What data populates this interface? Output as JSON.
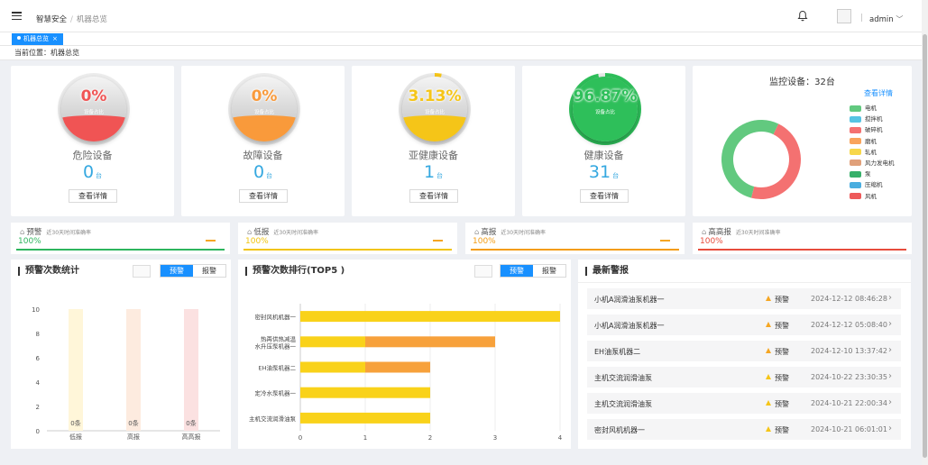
{
  "header": {
    "breadcrumb_root": "智慧安全",
    "breadcrumb_sep": "/",
    "breadcrumb_current": "机器总览",
    "user": "admin",
    "bell_icon": "bell-icon",
    "menu_icon": "menu-fold-icon"
  },
  "tab": {
    "label": "机器总览",
    "close": "×"
  },
  "location": "当前位置：机器总览",
  "devices": [
    {
      "pct": "0%",
      "sub": "设备占比",
      "name": "危险设备",
      "count": "0",
      "unit": "台",
      "btn": "查看详情",
      "color": "#f05454",
      "level": 0
    },
    {
      "pct": "0%",
      "sub": "设备占比",
      "name": "故障设备",
      "count": "0",
      "unit": "台",
      "btn": "查看详情",
      "color": "#f99a3b",
      "level": 0
    },
    {
      "pct": "3.13%",
      "sub": "设备占比",
      "name": "亚健康设备",
      "count": "1",
      "unit": "台",
      "btn": "查看详情",
      "color": "#f5c518",
      "level": 0.0313
    },
    {
      "pct": "96.87%",
      "sub": "设备占比",
      "name": "健康设备",
      "count": "31",
      "unit": "台",
      "btn": "查看详情",
      "color": "#2ebf5a",
      "level": 0.9687
    }
  ],
  "monitor": {
    "title": "监控设备：32台",
    "link": "查看详情",
    "legend": [
      {
        "name": "电机",
        "color": "#62c97f"
      },
      {
        "name": "搅拌机",
        "color": "#56c4e3"
      },
      {
        "name": "破碎机",
        "color": "#f47171"
      },
      {
        "name": "磨机",
        "color": "#f9a45c"
      },
      {
        "name": "轧机",
        "color": "#f7d74a"
      },
      {
        "name": "风力发电机",
        "color": "#e0a07a"
      },
      {
        "name": "泵",
        "color": "#36b06a"
      },
      {
        "name": "压缩机",
        "color": "#4aaee0"
      },
      {
        "name": "风机",
        "color": "#ee5a5a"
      }
    ],
    "donut": [
      {
        "label": "风机",
        "value": 15,
        "color": "#f47171"
      },
      {
        "label": "电机",
        "value": 17,
        "color": "#62c97f"
      }
    ]
  },
  "accuracy": [
    {
      "label": "预警",
      "note": "近30天时间准确率",
      "value": "100%",
      "color": "#2db55d",
      "text_color": "#2db55d",
      "dash": "#f5a623"
    },
    {
      "label": "低报",
      "note": "近30天时间准确率",
      "value": "100%",
      "color": "#f1c40f",
      "text_color": "#f1c40f",
      "dash": "#f5a623"
    },
    {
      "label": "高报",
      "note": "近30天时间准确率",
      "value": "100%",
      "color": "#f39c12",
      "text_color": "#f39c12",
      "dash": "#f5a623"
    },
    {
      "label": "高高报",
      "note": "近30天时间准确率",
      "value": "100%",
      "color": "#e74c3c",
      "text_color": "#e74c3c",
      "dash": ""
    }
  ],
  "stats_panel": {
    "title": "预警次数统计",
    "tab_warn": "预警",
    "tab_alarm": "报警"
  },
  "top5_panel": {
    "title": "预警次数排行(TOP5 )",
    "tab_warn": "预警",
    "tab_alarm": "报警"
  },
  "alerts_panel": {
    "title": "最新警报",
    "rows": [
      {
        "device": "小机A润滑油泵机器一",
        "level": "预警",
        "time": "2024-12-12 08:46:28",
        "color": "#f5a623"
      },
      {
        "device": "小机A润滑油泵机器一",
        "level": "预警",
        "time": "2024-12-12 05:08:40",
        "color": "#f5a623"
      },
      {
        "device": "EH油泵机器二",
        "level": "预警",
        "time": "2024-12-10 13:37:42",
        "color": "#f5a623"
      },
      {
        "device": "主机交流润滑油泵",
        "level": "预警",
        "time": "2024-10-22 23:30:35",
        "color": "#f5c518"
      },
      {
        "device": "主机交流润滑油泵",
        "level": "预警",
        "time": "2024-10-21 22:00:34",
        "color": "#f5c518"
      },
      {
        "device": "密封风机机器一",
        "level": "预警",
        "time": "2024-10-21 06:01:01",
        "color": "#f5c518"
      }
    ]
  },
  "chart_data": [
    {
      "type": "bar",
      "categories": [
        "低报",
        "高报",
        "高高报"
      ],
      "values": [
        0,
        0,
        0
      ],
      "data_labels": [
        "0条",
        "0条",
        "0条"
      ],
      "ylim": [
        0,
        10
      ],
      "yticks": [
        0,
        2,
        4,
        6,
        8,
        10
      ],
      "bg_colors": [
        "#fff6d9",
        "#fdebdf",
        "#fbe1e1"
      ]
    },
    {
      "type": "bar",
      "orientation": "horizontal",
      "categories": [
        "密封风机机器一",
        "热再供热减温水升压泵机器一",
        "EH油泵机器二",
        "定冷水泵机器一",
        "主机交流润滑油泵"
      ],
      "category_lines": [
        [
          "密封风机机器一"
        ],
        [
          "热再供热减温",
          "水升压泵机器一"
        ],
        [
          "EH油泵机器二"
        ],
        [
          "定冷水泵机器一"
        ],
        [
          "主机交流润滑油泵"
        ]
      ],
      "series": [
        {
          "values": [
            4,
            1,
            1,
            2,
            2
          ],
          "color": "#f9d21a"
        },
        {
          "values": [
            0,
            2,
            1,
            0,
            0
          ],
          "color": "#f7a13b"
        }
      ],
      "xlim": [
        0,
        4
      ],
      "xticks": [
        0,
        1,
        2,
        3,
        4
      ]
    }
  ]
}
